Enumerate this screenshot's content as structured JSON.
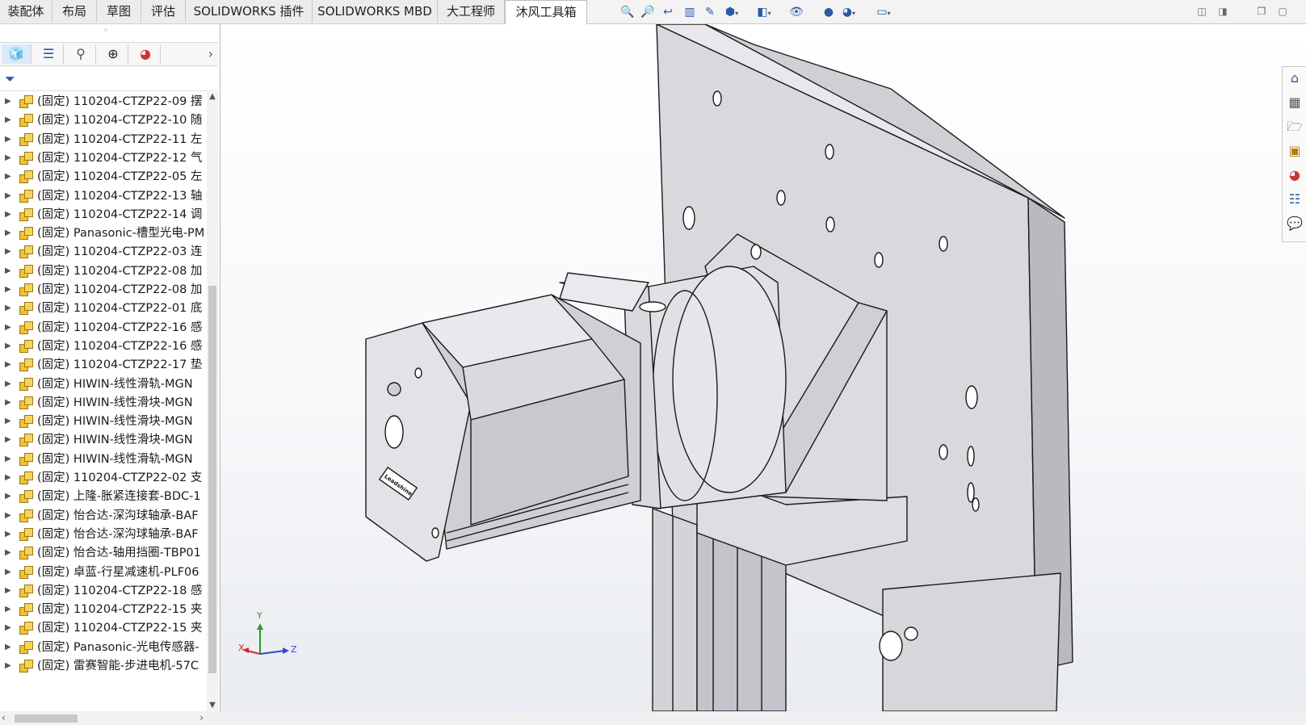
{
  "tabs": [
    {
      "label": "装配体",
      "active": false
    },
    {
      "label": "布局",
      "active": false
    },
    {
      "label": "草图",
      "active": false
    },
    {
      "label": "评估",
      "active": false
    },
    {
      "label": "SOLIDWORKS 插件",
      "active": false
    },
    {
      "label": "SOLIDWORKS MBD",
      "active": false
    },
    {
      "label": "大工程师",
      "active": false
    },
    {
      "label": "沐风工具箱",
      "active": true
    }
  ],
  "toolbar_icons": [
    "zoom-to-fit-icon",
    "zoom-area-icon",
    "previous-view-icon",
    "section-view-icon",
    "dynamic-annotation-icon",
    "view-orientation-icon",
    "display-style-icon",
    "hide-show-icon",
    "edit-appearance-icon",
    "apply-scene-icon",
    "view-settings-icon"
  ],
  "panel": {
    "grip": "◦",
    "tabs": [
      "feature-manager-icon",
      "property-manager-icon",
      "configuration-manager-icon",
      "dimxpert-icon",
      "display-manager-icon"
    ]
  },
  "tree_items": [
    "(固定) 110204-CTZP22-09 摆",
    "(固定) 110204-CTZP22-10 随",
    "(固定) 110204-CTZP22-11 左",
    "(固定) 110204-CTZP22-12 气",
    "(固定) 110204-CTZP22-05 左",
    "(固定) 110204-CTZP22-13 轴",
    "(固定) 110204-CTZP22-14 调",
    "(固定) Panasonic-槽型光电-PM",
    "(固定) 110204-CTZP22-03 连",
    "(固定) 110204-CTZP22-08 加",
    "(固定) 110204-CTZP22-08 加",
    "(固定) 110204-CTZP22-01 底",
    "(固定) 110204-CTZP22-16 感",
    "(固定) 110204-CTZP22-16 感",
    "(固定) 110204-CTZP22-17 垫",
    "(固定) HIWIN-线性滑轨-MGN",
    "(固定) HIWIN-线性滑块-MGN",
    "(固定) HIWIN-线性滑块-MGN",
    "(固定) HIWIN-线性滑块-MGN",
    "(固定) HIWIN-线性滑轨-MGN",
    "(固定) 110204-CTZP22-02 支",
    "(固定) 上隆-胀紧连接套-BDC-1",
    "(固定) 怡合达-深沟球轴承-BAF",
    "(固定) 怡合达-深沟球轴承-BAF",
    "(固定) 怡合达-轴用挡圈-TBP01",
    "(固定) 卓蓝-行星减速机-PLF06",
    "(固定) 110204-CTZP22-18 感",
    "(固定) 110204-CTZP22-15 夹",
    "(固定) 110204-CTZP22-15 夹",
    "(固定) Panasonic-光电传感器-",
    "(固定) 雷赛智能-步进电机-57C"
  ],
  "motor_label": "Leadshine",
  "triad": {
    "x": "X",
    "y": "Y",
    "z": "Z"
  },
  "task_pane": [
    "home-icon",
    "design-library-icon",
    "file-explorer-icon",
    "view-palette-icon",
    "appearances-icon",
    "custom-properties-icon",
    "forum-icon"
  ]
}
